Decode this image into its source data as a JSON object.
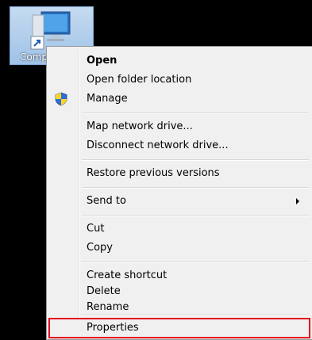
{
  "desktop": {
    "icon_label": "Computer"
  },
  "menu": {
    "items": [
      {
        "label": "Open"
      },
      {
        "label": "Open folder location"
      },
      {
        "label": "Manage"
      },
      {
        "label": "Map network drive..."
      },
      {
        "label": "Disconnect network drive..."
      },
      {
        "label": "Restore previous versions"
      },
      {
        "label": "Send to"
      },
      {
        "label": "Cut"
      },
      {
        "label": "Copy"
      },
      {
        "label": "Create shortcut"
      },
      {
        "label": "Delete"
      },
      {
        "label": "Rename"
      },
      {
        "label": "Properties"
      }
    ]
  },
  "colors": {
    "highlight_border": "#e3001b",
    "menu_background": "#f0f0f0",
    "desktop_background": "#000000"
  },
  "icons": {
    "desktop": "computer-icon",
    "shortcut_overlay": "shortcut-arrow-icon",
    "manage": "uac-shield-icon",
    "send_to": "chevron-right-icon"
  }
}
